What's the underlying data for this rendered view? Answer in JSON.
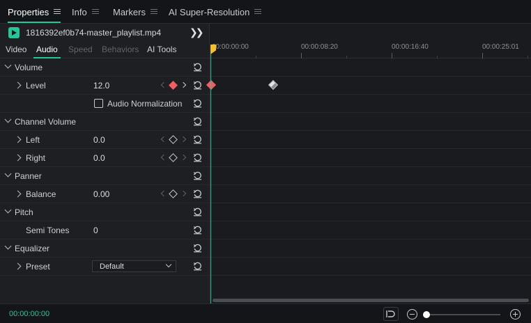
{
  "tabs": [
    {
      "label": "Properties",
      "active": true
    },
    {
      "label": "Info"
    },
    {
      "label": "Markers"
    },
    {
      "label": "AI Super-Resolution"
    }
  ],
  "file": {
    "name": "1816392ef0b74-master_playlist.mp4",
    "icon": "play-icon",
    "expand_icon": "double-chevron-right-icon"
  },
  "subtabs": [
    {
      "label": "Video"
    },
    {
      "label": "Audio",
      "active": true
    },
    {
      "label": "Speed",
      "disabled": true
    },
    {
      "label": "Behaviors",
      "disabled": true
    },
    {
      "label": "AI Tools"
    }
  ],
  "properties": {
    "volume": {
      "label": "Volume",
      "level_label": "Level",
      "level_value": "12.0",
      "normalization_label": "Audio Normalization",
      "normalization_checked": false
    },
    "channel_volume": {
      "label": "Channel Volume",
      "left_label": "Left",
      "left_value": "0.0",
      "right_label": "Right",
      "right_value": "0.0"
    },
    "panner": {
      "label": "Panner",
      "balance_label": "Balance",
      "balance_value": "0.00"
    },
    "pitch": {
      "label": "Pitch",
      "semitones_label": "Semi Tones",
      "semitones_value": "0"
    },
    "equalizer": {
      "label": "Equalizer",
      "preset_label": "Preset",
      "preset_value": "Default"
    }
  },
  "timeline": {
    "ruler_labels": [
      "00:00:00:00",
      "00:00:08:20",
      "00:00:16:40",
      "00:00:25:01"
    ]
  },
  "bottom": {
    "timecode": "00:00:00:00"
  },
  "colors": {
    "accent": "#27c59a",
    "keyframe_active": "#f05d63",
    "playhead": "#f2c22e",
    "background": "#1e1f22"
  }
}
